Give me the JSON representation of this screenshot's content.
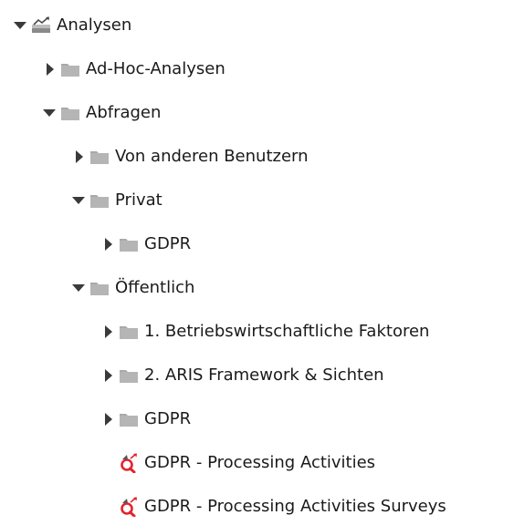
{
  "colors": {
    "folder": "#a9a9a9",
    "folder_tab": "#8f8f8f",
    "toggle": "#3a3a3a",
    "query_icon_red": "#e3232e",
    "query_icon_dark": "#555555",
    "text": "#1a1a1a"
  },
  "tree": {
    "root": {
      "label": "Analysen",
      "icon": "analysis-root-icon",
      "state": "expanded"
    },
    "adhoc": {
      "label": "Ad-Hoc-Analysen",
      "icon": "folder-icon",
      "state": "collapsed"
    },
    "abfragen": {
      "label": "Abfragen",
      "icon": "folder-icon",
      "state": "expanded"
    },
    "von_anderen": {
      "label": "Von anderen Benutzern",
      "icon": "folder-icon",
      "state": "collapsed"
    },
    "privat": {
      "label": "Privat",
      "icon": "folder-icon",
      "state": "expanded"
    },
    "privat_gdpr": {
      "label": "GDPR",
      "icon": "folder-icon",
      "state": "collapsed"
    },
    "oeffentlich": {
      "label": "Öffentlich",
      "icon": "folder-icon",
      "state": "expanded"
    },
    "betriebs": {
      "label": "1. Betriebswirtschaftliche Faktoren",
      "icon": "folder-icon",
      "state": "collapsed"
    },
    "aris": {
      "label": "2. ARIS Framework & Sichten",
      "icon": "folder-icon",
      "state": "collapsed"
    },
    "oeff_gdpr": {
      "label": "GDPR",
      "icon": "folder-icon",
      "state": "collapsed"
    },
    "processing": {
      "label": "GDPR - Processing Activities",
      "icon": "query-icon",
      "state": "leaf"
    },
    "surveys": {
      "label": "GDPR - Processing Activities Surveys",
      "icon": "query-icon",
      "state": "leaf"
    }
  }
}
